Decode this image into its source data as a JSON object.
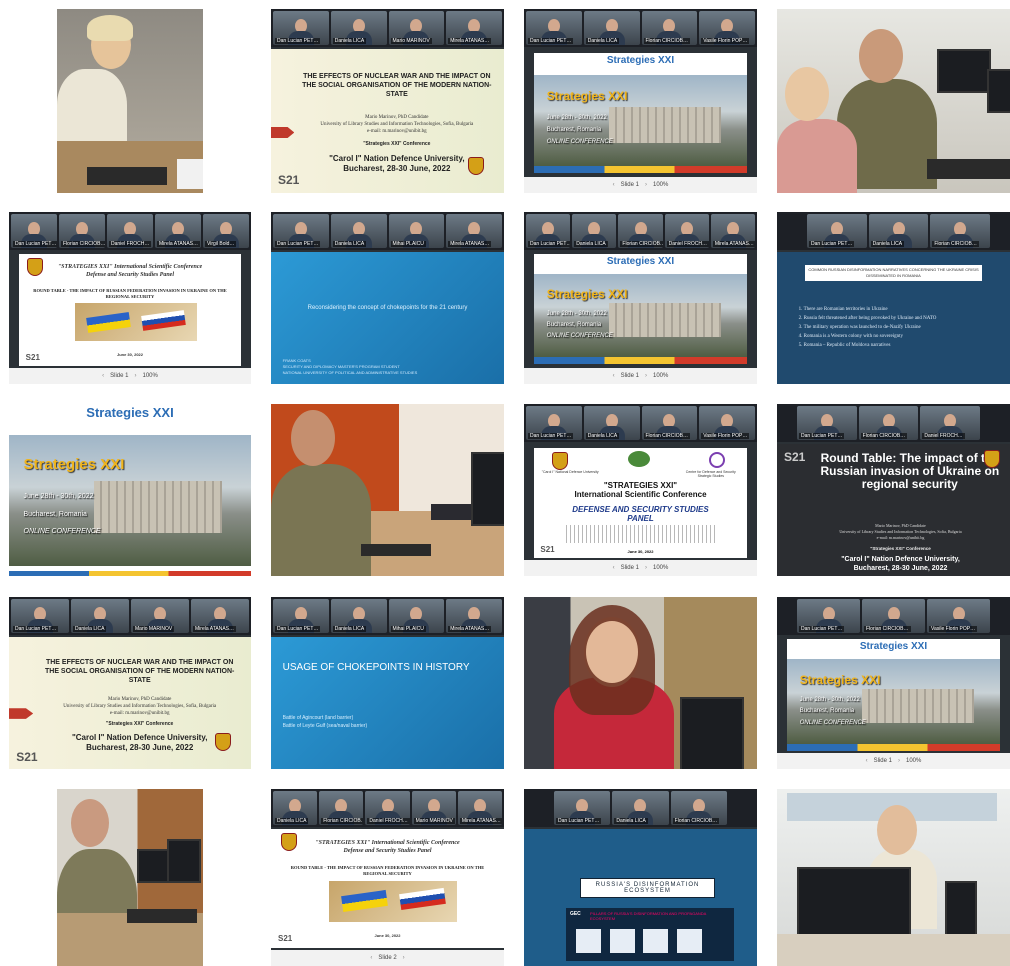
{
  "meeting": {
    "participants": [
      "Dan Lucian PET…",
      "Daniela LICA",
      "Mario MARINOV",
      "Mirela ATANAS…",
      "Florian CIRCIOB…",
      "Vasile Florin POP…",
      "Daniel FROCH…",
      "Mihai PLAICU",
      "Virgil Bold…"
    ]
  },
  "slide_controls": {
    "slide1": "Slide 1",
    "slide2": "Slide 2",
    "zoom": "100%"
  },
  "strategies": {
    "header": "Strategies XXI",
    "title": "Strategies XXI",
    "dates": "June 28th - 30th, 2022",
    "location": "Bucharest, Romania",
    "mode": "ONLINE CONFERENCE"
  },
  "nuclear": {
    "title": "THE EFFECTS OF NUCLEAR WAR AND THE IMPACT ON THE SOCIAL ORGANISATION OF THE MODERN NATION-STATE",
    "author": "Mario Marinov, PhD Candidate",
    "affiliation": "University of Library Studies and Information Technologies, Sofia, Bulgaria",
    "email": "e-mail: m.marinov@unibit.bg",
    "conference": "\"Strategies XXI\" Conference",
    "university": "\"Carol I\" Nation Defence University,",
    "place_date": "Bucharest, 28-30 June, 2022"
  },
  "chokepoints": {
    "title": "Reconsidering the concept of chokepoints for the 21 century",
    "author": "FRANK COATS",
    "role": "SECURITY AND DIPLOMACY MASTER'S PROGRAM STUDENT",
    "school": "NATIONAL UNIVERSITY OF POLITICAL AND ADMINISTRATIVE STUDIES"
  },
  "usage": {
    "title": "USAGE OF CHOKEPOINTS IN HISTORY",
    "item1": "Battle of Agincourt (land barrier)",
    "item2": "Battle of Leyte Gulf (sea/naval barrier)"
  },
  "narratives": {
    "header": "COMMON RUSSIAN DISINFORMATION NARRATIVES CONCERNING THE UKRAINE CRISIS DISSEMINATED IN ROMANIA",
    "items": [
      "There are Romanian territories in Ukraine",
      "Russia felt threatened after being provoked by Ukraine and NATO",
      "The military operation was launched to de-Nazify Ukraine",
      "Romania is a Western colony with no sovereignty",
      "Romania – Republic of Moldova narratives"
    ]
  },
  "roundtable": {
    "conf": "\"STRATEGIES XXI\" International Scientific Conference",
    "panel": "Defense and Security Studies Panel",
    "title": "ROUND TABLE - THE IMPACT OF RUSSIAN FEDERATION INVASION IN UKRAINE ON THE REGIONAL SECURITY",
    "date": "June 30, 2022"
  },
  "roundtable_dark": {
    "title": "Round Table: The impact of the Russian invasion of Ukraine on regional security",
    "author": "Mario Marinov, PhD Candidate",
    "affiliation": "University of Library Studies and Information Technologies, Sofia, Bulgaria",
    "email": "e-mail: m.marinov@unibit.bg",
    "conference": "\"Strategies XXI\" Conference",
    "university": "\"Carol I\" Nation Defence University,",
    "place_date": "Bucharest, 28-30 June, 2022"
  },
  "conference_panel": {
    "left_logo": "\"Carol I\" National Defence University",
    "right_logo": "Centre for Defence and Security Strategic Studies",
    "line1": "\"STRATEGIES XXI\"",
    "line2": "International Scientific Conference",
    "line3": "DEFENSE AND SECURITY STUDIES",
    "line4": "PANEL",
    "date": "June 30, 2022"
  },
  "ecosystem": {
    "title": "RUSSIA'S DISINFORMATION ECOSYSTEM",
    "brand": "GEC",
    "subtitle": "PILLARS OF RUSSIA'S DISINFORMATION AND PROPAGANDA ECOSYSTEM"
  },
  "logo": {
    "s21": "S21",
    "isc": "ISC"
  }
}
